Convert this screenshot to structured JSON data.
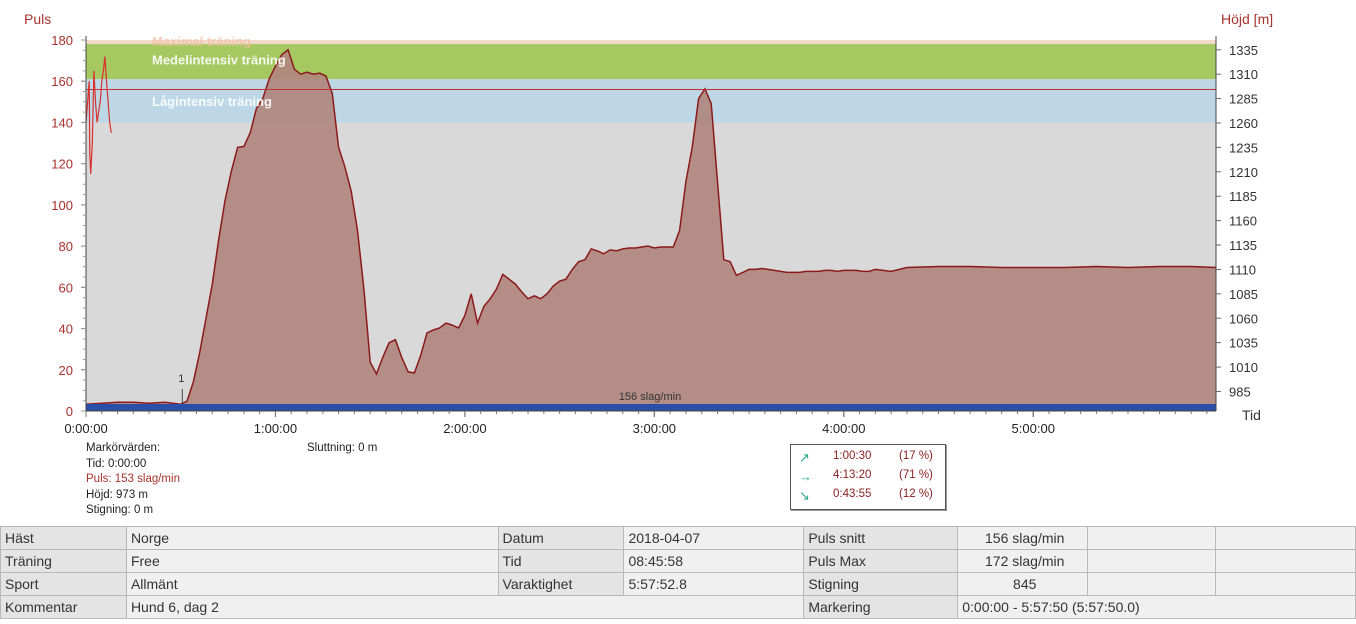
{
  "axes": {
    "left_title": "Puls",
    "right_title": "Höjd [m]",
    "x_title": "Tid",
    "left_ticks": [
      "0",
      "20",
      "40",
      "60",
      "80",
      "100",
      "120",
      "140",
      "160",
      "180"
    ],
    "right_ticks": [
      "985",
      "1010",
      "1035",
      "1060",
      "1085",
      "1110",
      "1135",
      "1160",
      "1185",
      "1210",
      "1235",
      "1260",
      "1285",
      "1310",
      "1335"
    ],
    "x_ticks": [
      "0:00:00",
      "1:00:00",
      "2:00:00",
      "3:00:00",
      "4:00:00",
      "5:00:00"
    ]
  },
  "zones": {
    "top": "Maximal träning",
    "middle": "Medelintensiv träning",
    "low": "Lågintensiv träning"
  },
  "avg_line_label": "156 slag/min",
  "marker_number": "1",
  "marker_values": {
    "title": "Markörvärden:",
    "time": "Tid: 0:00:00",
    "pulse": "Puls: 153 slag/min",
    "height": "Höjd: 973 m",
    "climb": "Stigning: 0 m",
    "slope": "Sluttning: 0 m"
  },
  "gradient": [
    {
      "icon": "arrow-up-right-icon",
      "glyph": "↗",
      "time": "1:00:30",
      "pct": "(17 %)"
    },
    {
      "icon": "arrow-right-icon",
      "glyph": "→",
      "time": "4:13:20",
      "pct": "(71 %)"
    },
    {
      "icon": "arrow-down-right-icon",
      "glyph": "↘",
      "time": "0:43:55",
      "pct": "(12 %)"
    }
  ],
  "table": {
    "r1": {
      "l1": "Häst",
      "v1": "Norge",
      "l2": "Datum",
      "v2": "2018-04-07",
      "l3": "Puls snitt",
      "v3": "156 slag/min"
    },
    "r2": {
      "l1": "Träning",
      "v1": "Free",
      "l2": "Tid",
      "v2": "08:45:58",
      "l3": "Puls Max",
      "v3": "172 slag/min"
    },
    "r3": {
      "l1": "Sport",
      "v1": "Allmänt",
      "l2": "Varaktighet",
      "v2": "5:57:52.8",
      "l3": "Stigning",
      "v3": "845"
    },
    "r4": {
      "l1": "Kommentar",
      "v1": "Hund 6, dag 2",
      "l2": "Markering",
      "v2": "0:00:00 - 5:57:50 (5:57:50.0)"
    }
  },
  "colors": {
    "plot_bg": "#d9d9d9",
    "zone_top": "#f2d9c9",
    "zone_mid": "#a5c861",
    "zone_low": "#bdd7e6",
    "area_fill": "#b0877f",
    "area_line": "#8b1a1a",
    "pulse_line": "#d8302c",
    "bottom_band": "#2a4fa8"
  },
  "chart_data": {
    "type": "area",
    "title": "",
    "xlabel": "Tid",
    "ylabel": "Puls",
    "y2label": "Höjd [m]",
    "xlim": [
      "0:00:00",
      "5:57:52"
    ],
    "ylim": [
      0,
      180
    ],
    "y2lim": [
      965,
      1345
    ],
    "grid": false,
    "zones": [
      {
        "name": "Maximal träning",
        "range": [
          178,
          180
        ]
      },
      {
        "name": "Medelintensiv träning",
        "range": [
          161,
          178
        ]
      },
      {
        "name": "Lågintensiv träning",
        "range": [
          140,
          161
        ]
      }
    ],
    "reference_line": {
      "label": "156 slag/min",
      "value": 156
    },
    "series": [
      {
        "name": "Höjd [m]",
        "axis": "right",
        "x_minutes": [
          0,
          5,
          10,
          15,
          20,
          25,
          30,
          32,
          34,
          36,
          38,
          40,
          42,
          44,
          46,
          48,
          50,
          52,
          54,
          56,
          58,
          60,
          62,
          64,
          66,
          68,
          70,
          72,
          74,
          76,
          78,
          80,
          82,
          84,
          86,
          88,
          90,
          92,
          94,
          96,
          98,
          100,
          102,
          104,
          106,
          108,
          110,
          112,
          114,
          116,
          118,
          120,
          122,
          124,
          126,
          128,
          130,
          132,
          134,
          136,
          138,
          140,
          142,
          144,
          146,
          148,
          150,
          152,
          154,
          156,
          158,
          160,
          162,
          164,
          166,
          168,
          170,
          172,
          174,
          176,
          178,
          180,
          182,
          184,
          186,
          188,
          190,
          192,
          194,
          196,
          198,
          200,
          202,
          204,
          206,
          208,
          210,
          212,
          214,
          216,
          218,
          220,
          222,
          224,
          226,
          228,
          230,
          232,
          234,
          236,
          238,
          240,
          242,
          244,
          246,
          248,
          250,
          255,
          260,
          270,
          280,
          290,
          300,
          310,
          320,
          330,
          340,
          350,
          358
        ],
        "values": [
          972,
          973,
          974,
          974,
          973,
          974,
          972,
          975,
          995,
          1025,
          1060,
          1095,
          1140,
          1180,
          1210,
          1235,
          1236,
          1250,
          1275,
          1285,
          1305,
          1318,
          1330,
          1335,
          1315,
          1310,
          1312,
          1310,
          1311,
          1308,
          1290,
          1235,
          1215,
          1190,
          1150,
          1090,
          1015,
          1003,
          1020,
          1035,
          1038,
          1020,
          1005,
          1004,
          1022,
          1045,
          1048,
          1050,
          1055,
          1053,
          1050,
          1063,
          1085,
          1055,
          1072,
          1080,
          1090,
          1105,
          1100,
          1095,
          1087,
          1080,
          1083,
          1080,
          1085,
          1093,
          1098,
          1100,
          1110,
          1118,
          1120,
          1131,
          1129,
          1126,
          1130,
          1129,
          1131,
          1132,
          1132,
          1133,
          1134,
          1132,
          1133,
          1133,
          1133,
          1150,
          1200,
          1235,
          1285,
          1295,
          1280,
          1200,
          1120,
          1118,
          1104,
          1107,
          1110,
          1110,
          1111,
          1110,
          1109,
          1108,
          1107,
          1107,
          1107,
          1108,
          1108,
          1108,
          1109,
          1109,
          1108,
          1109,
          1109,
          1109,
          1108,
          1108,
          1110,
          1108,
          1112,
          1113,
          1113,
          1112,
          1112,
          1112,
          1113,
          1112,
          1113,
          1113,
          1112
        ]
      },
      {
        "name": "Puls",
        "axis": "left",
        "x_minutes": [
          0,
          0.5,
          1,
          1.2,
          1.5,
          2,
          2.5,
          3,
          3.5,
          4,
          4.5,
          5,
          5.5,
          6,
          6.5,
          7,
          7.5,
          8
        ],
        "values": [
          140,
          150,
          160,
          125,
          115,
          130,
          165,
          150,
          140,
          145,
          150,
          160,
          165,
          172,
          160,
          150,
          140,
          135
        ]
      }
    ]
  }
}
